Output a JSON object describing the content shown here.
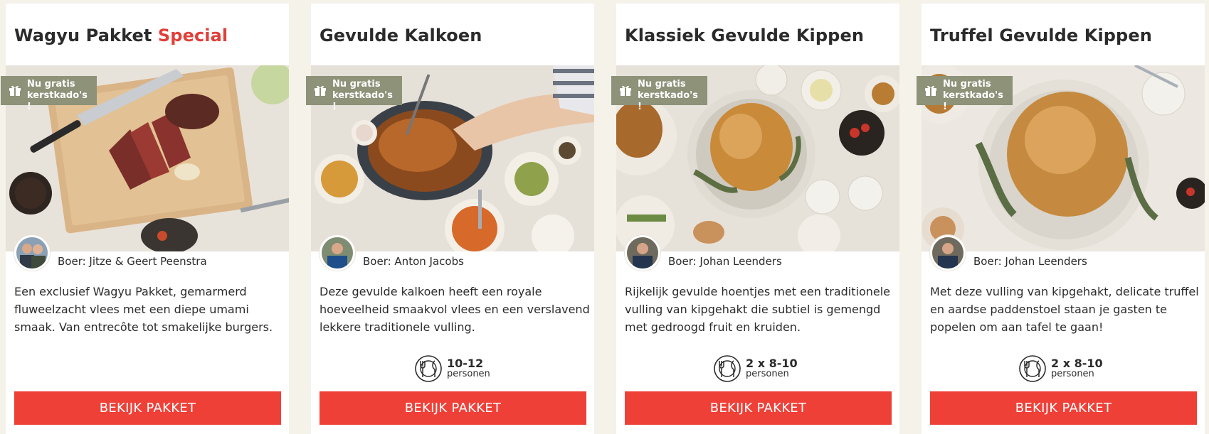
{
  "badge_text": "Nu gratis kerstkado's !",
  "accent_color": "#e0403a",
  "button_color": "#ef4038",
  "badge_color": "#8d9278",
  "products": [
    {
      "title": "Wagyu Pakket",
      "title_accent": "Special",
      "farmer": "Boer: Jitze & Geert Peenstra",
      "description": "Een exclusief Wagyu Pakket, gemarmerd fluweelzacht vlees met een diepe umami smaak. Van entrecôte tot smakelijke burgers.",
      "persons_count": "",
      "persons_unit": "",
      "button_label": "BEKIJK PAKKET",
      "photo_icon": "wagyu-steak-photo"
    },
    {
      "title": "Gevulde Kalkoen",
      "title_accent": "",
      "farmer": "Boer: Anton Jacobs",
      "description": "Deze gevulde kalkoen heeft een royale hoeveelheid smaakvol vlees en een verslavend lekkere traditionele vulling.",
      "persons_count": "10-12",
      "persons_unit": "personen",
      "button_label": "BEKIJK PAKKET",
      "photo_icon": "turkey-photo"
    },
    {
      "title": "Klassiek Gevulde Kippen",
      "title_accent": "",
      "farmer": "Boer: Johan Leenders",
      "description": "Rijkelijk gevulde hoentjes met een traditionele vulling van kipgehakt die subtiel is gemengd met gedroogd fruit en kruiden.",
      "persons_count": "2 x 8-10",
      "persons_unit": "personen",
      "button_label": "BEKIJK PAKKET",
      "photo_icon": "roast-chicken-photo"
    },
    {
      "title": "Truffel Gevulde Kippen",
      "title_accent": "",
      "farmer": "Boer: Johan Leenders",
      "description": "Met deze vulling van kipgehakt, delicate truffel en aardse paddenstoel staan je gasten te popelen om aan tafel te gaan!",
      "persons_count": "2 x 8-10",
      "persons_unit": "personen",
      "button_label": "BEKIJK PAKKET",
      "photo_icon": "truffle-chicken-photo"
    }
  ]
}
